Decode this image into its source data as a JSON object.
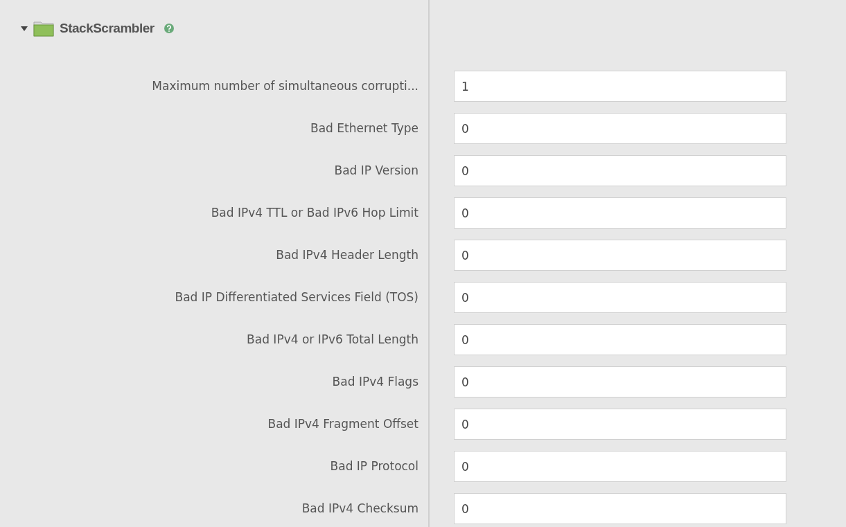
{
  "section": {
    "title": "StackScrambler",
    "expanded": true
  },
  "fields": [
    {
      "label": "Maximum number of simultaneous corrupti...",
      "value": "1"
    },
    {
      "label": "Bad Ethernet Type",
      "value": "0"
    },
    {
      "label": "Bad IP Version",
      "value": "0"
    },
    {
      "label": "Bad IPv4 TTL or Bad IPv6 Hop Limit",
      "value": "0"
    },
    {
      "label": "Bad IPv4 Header Length",
      "value": "0"
    },
    {
      "label": "Bad IP Differentiated Services Field (TOS)",
      "value": "0"
    },
    {
      "label": "Bad IPv4 or IPv6 Total Length",
      "value": "0"
    },
    {
      "label": "Bad IPv4 Flags",
      "value": "0"
    },
    {
      "label": "Bad IPv4 Fragment Offset",
      "value": "0"
    },
    {
      "label": "Bad IP Protocol",
      "value": "0"
    },
    {
      "label": "Bad IPv4 Checksum",
      "value": "0"
    }
  ]
}
